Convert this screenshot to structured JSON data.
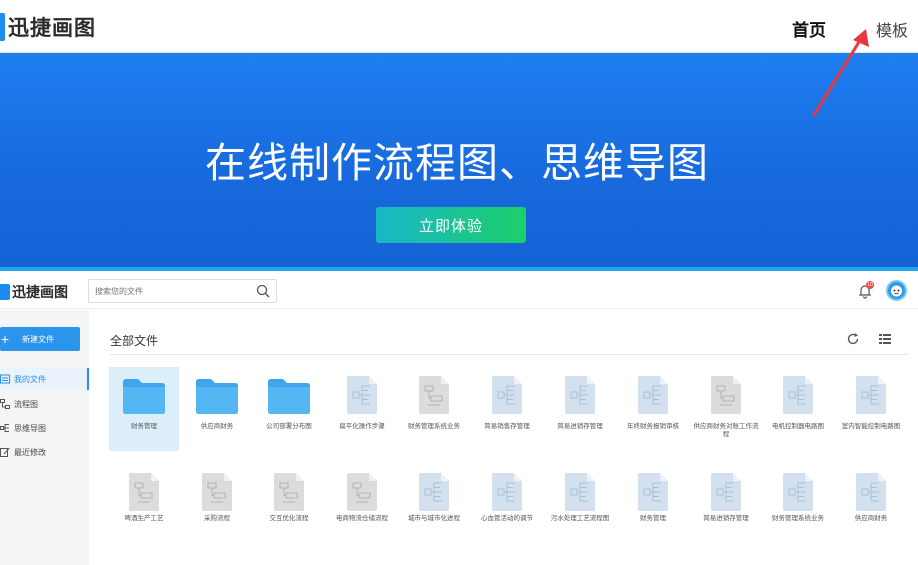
{
  "topnav": {
    "logo": "迅捷画图",
    "home": "首页",
    "templates": "模板"
  },
  "hero": {
    "title": "在线制作流程图、思维导图",
    "cta": "立即体验"
  },
  "app": {
    "logo": "迅捷画图",
    "search_placeholder": "搜索您的文件",
    "notifications": "10"
  },
  "sidebar": {
    "new_file": "新建文件",
    "items": [
      {
        "label": "我的文件",
        "icon": "my-files-icon",
        "active": true
      },
      {
        "label": "流程图",
        "icon": "flowchart-icon",
        "active": false
      },
      {
        "label": "思维导图",
        "icon": "mindmap-icon",
        "active": false
      },
      {
        "label": "最近修改",
        "icon": "recent-icon",
        "active": false
      }
    ]
  },
  "main": {
    "title": "全部文件",
    "files": [
      {
        "name": "财务管理",
        "type": "folder"
      },
      {
        "name": "供应商财务",
        "type": "folder"
      },
      {
        "name": "公司部署分布图",
        "type": "folder"
      },
      {
        "name": "扁平化操作步骤",
        "type": "mindmap"
      },
      {
        "name": "财务管理系统业务",
        "type": "flowchart"
      },
      {
        "name": "简易销售存管理",
        "type": "mindmap"
      },
      {
        "name": "简易进销存管理",
        "type": "mindmap"
      },
      {
        "name": "年终财务报销审核",
        "type": "mindmap"
      },
      {
        "name": "供应商财务对账工作流程",
        "type": "flowchart"
      },
      {
        "name": "电机控制器电路图",
        "type": "mindmap"
      },
      {
        "name": "室内智能控制电路图",
        "type": "mindmap"
      },
      {
        "name": "啤酒生产工艺",
        "type": "flowchart"
      },
      {
        "name": "采购流程",
        "type": "flowchart"
      },
      {
        "name": "交互优化流程",
        "type": "flowchart"
      },
      {
        "name": "电商物流仓储流程",
        "type": "flowchart"
      },
      {
        "name": "城市与城市化进程",
        "type": "mindmap"
      },
      {
        "name": "心血管活动的调节",
        "type": "mindmap"
      },
      {
        "name": "污水处理工艺流程图",
        "type": "mindmap"
      },
      {
        "name": "财务管理",
        "type": "mindmap"
      },
      {
        "name": "简易进销存管理",
        "type": "mindmap"
      },
      {
        "name": "财务管理系统业务",
        "type": "mindmap"
      },
      {
        "name": "供应商财务",
        "type": "mindmap"
      }
    ]
  },
  "colors": {
    "brand": "#1c8cf0",
    "hero_top": "#1e7ef0",
    "cta_start": "#19b6c8",
    "cta_end": "#1ccf6a",
    "annotation_arrow": "#e8383d"
  }
}
